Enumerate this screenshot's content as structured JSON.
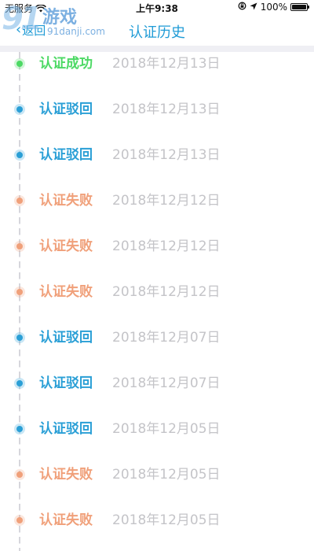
{
  "status_bar": {
    "carrier": "无服务",
    "time": "上午9:38",
    "battery": "100%",
    "icons": [
      "wifi-icon",
      "lock-rotation-icon",
      "location-arrow-icon",
      "battery-icon"
    ]
  },
  "nav": {
    "back_label": "返回",
    "title": "认证历史"
  },
  "watermark": {
    "digits": "91",
    "name": "游戏",
    "domain": "91danji.com"
  },
  "colors": {
    "accent": "#1f9bd6",
    "success": "#4cd964",
    "rejected": "#2a9fd6",
    "failed": "#f0a07a",
    "date": "#c4c4c8"
  },
  "history": [
    {
      "status": "认证成功",
      "date": "2018年12月13日",
      "kind": "success"
    },
    {
      "status": "认证驳回",
      "date": "2018年12月13日",
      "kind": "rejected"
    },
    {
      "status": "认证驳回",
      "date": "2018年12月13日",
      "kind": "rejected"
    },
    {
      "status": "认证失败",
      "date": "2018年12月12日",
      "kind": "failed"
    },
    {
      "status": "认证失败",
      "date": "2018年12月12日",
      "kind": "failed"
    },
    {
      "status": "认证失败",
      "date": "2018年12月12日",
      "kind": "failed"
    },
    {
      "status": "认证驳回",
      "date": "2018年12月07日",
      "kind": "rejected"
    },
    {
      "status": "认证驳回",
      "date": "2018年12月07日",
      "kind": "rejected"
    },
    {
      "status": "认证驳回",
      "date": "2018年12月05日",
      "kind": "rejected"
    },
    {
      "status": "认证失败",
      "date": "2018年12月05日",
      "kind": "failed"
    },
    {
      "status": "认证失败",
      "date": "2018年12月05日",
      "kind": "failed"
    }
  ]
}
